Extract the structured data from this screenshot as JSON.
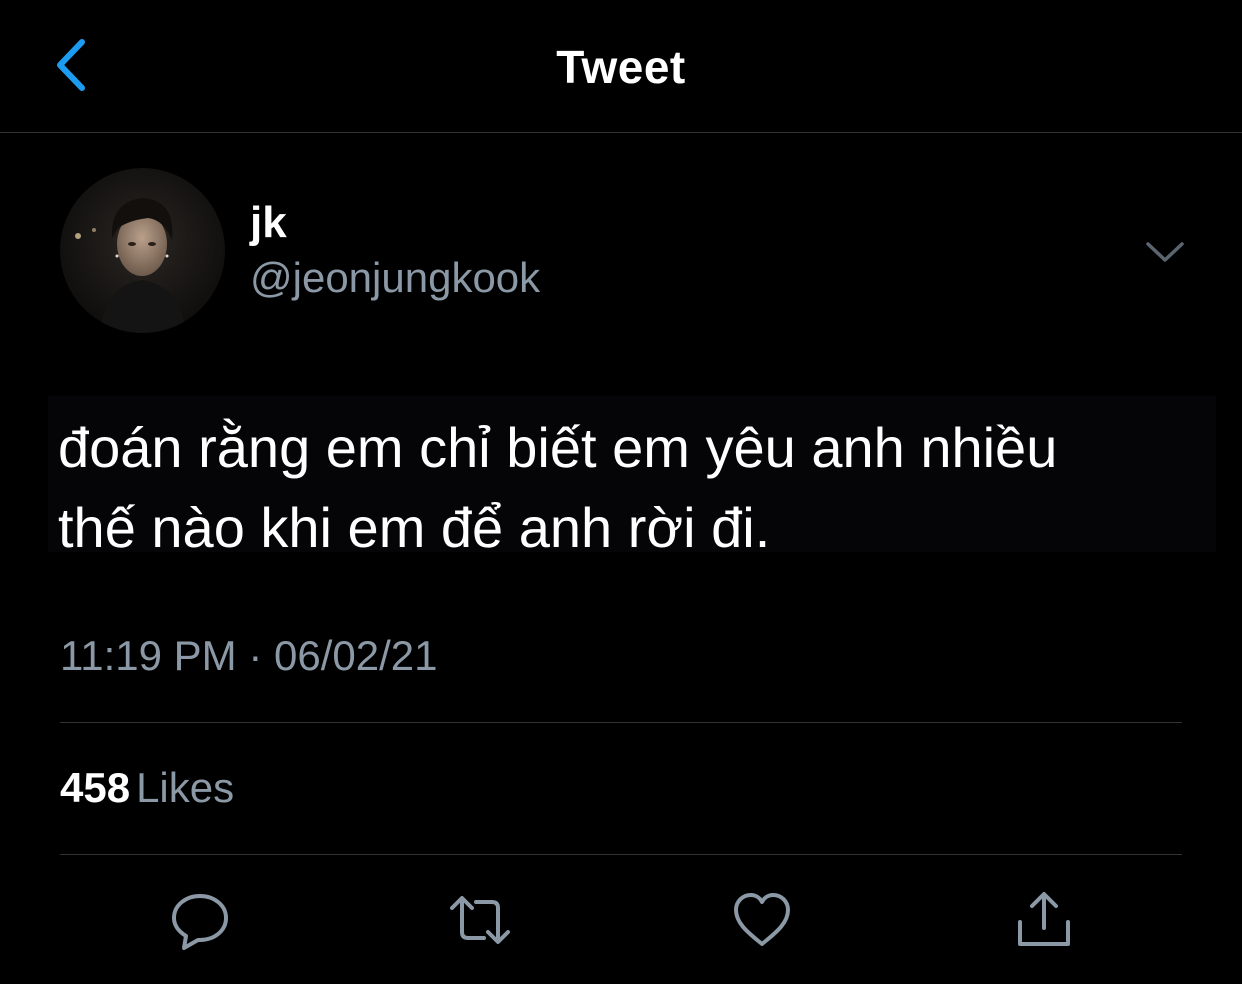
{
  "header": {
    "title": "Tweet",
    "back_icon": "chevron-left-icon",
    "accent_color": "#1d9bf0"
  },
  "author": {
    "display_name": "jk",
    "handle": "@jeonjungkook",
    "more_icon": "chevron-down-icon"
  },
  "tweet": {
    "text": "đoán rằng em chỉ biết em yêu anh nhiều\nthế nào khi em để anh rời đi.",
    "timestamp": "11:19 PM · 06/02/21"
  },
  "stats": {
    "likes_count": "458",
    "likes_label": "Likes"
  },
  "actions": [
    {
      "name": "reply",
      "icon": "comment-icon"
    },
    {
      "name": "retweet",
      "icon": "retweet-icon"
    },
    {
      "name": "like",
      "icon": "heart-icon"
    },
    {
      "name": "share",
      "icon": "share-icon"
    }
  ],
  "colors": {
    "background": "#000000",
    "secondary_text": "#8b98a5",
    "divider": "#2f3336"
  }
}
